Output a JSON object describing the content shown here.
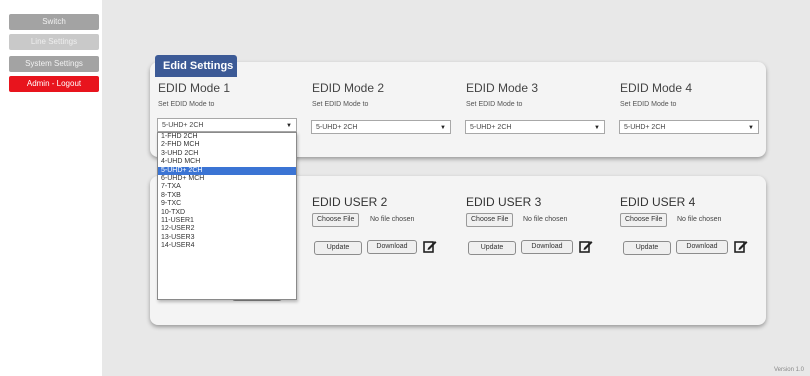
{
  "nav": {
    "items": [
      {
        "label": "Switch"
      },
      {
        "label": "Line Settings"
      },
      {
        "label": "System Settings"
      },
      {
        "label": "Admin - Logout"
      }
    ]
  },
  "edid_tab": {
    "label": "Edid Settings"
  },
  "modes": [
    {
      "title": "EDID Mode 1",
      "sub": "Set EDID Mode to",
      "value": "5-UHD+ 2CH"
    },
    {
      "title": "EDID Mode 2",
      "sub": "Set EDID Mode to",
      "value": "5-UHD+ 2CH"
    },
    {
      "title": "EDID Mode 3",
      "sub": "Set EDID Mode to",
      "value": "5-UHD+ 2CH"
    },
    {
      "title": "EDID Mode 4",
      "sub": "Set EDID Mode to",
      "value": "5-UHD+ 2CH"
    }
  ],
  "dropdown": {
    "options": [
      "1-FHD 2CH",
      "2-FHD MCH",
      "3-UHD 2CH",
      "4-UHD MCH",
      "5-UHD+ 2CH",
      "6-UHD+ MCH",
      "7-TXA",
      "8-TXB",
      "9-TXC",
      "10-TXD",
      "11-USER1",
      "12-USER2",
      "13-USER3",
      "14-USER4"
    ],
    "selected": "5-UHD+ 2CH"
  },
  "users": [
    {
      "title": "EDID USER 2",
      "choose_label": "Choose File",
      "no_file": "No file chosen",
      "update_label": "Update",
      "download_label": "Download"
    },
    {
      "title": "EDID USER 3",
      "choose_label": "Choose File",
      "no_file": "No file chosen",
      "update_label": "Update",
      "download_label": "Download"
    },
    {
      "title": "EDID USER 4",
      "choose_label": "Choose File",
      "no_file": "No file chosen",
      "update_label": "Update",
      "download_label": "Download"
    }
  ],
  "footer": {
    "version": "Version 1.0"
  },
  "colors": {
    "accent": "#3c5a96",
    "logout": "#e8141d",
    "selected_option": "#3b74d4"
  }
}
